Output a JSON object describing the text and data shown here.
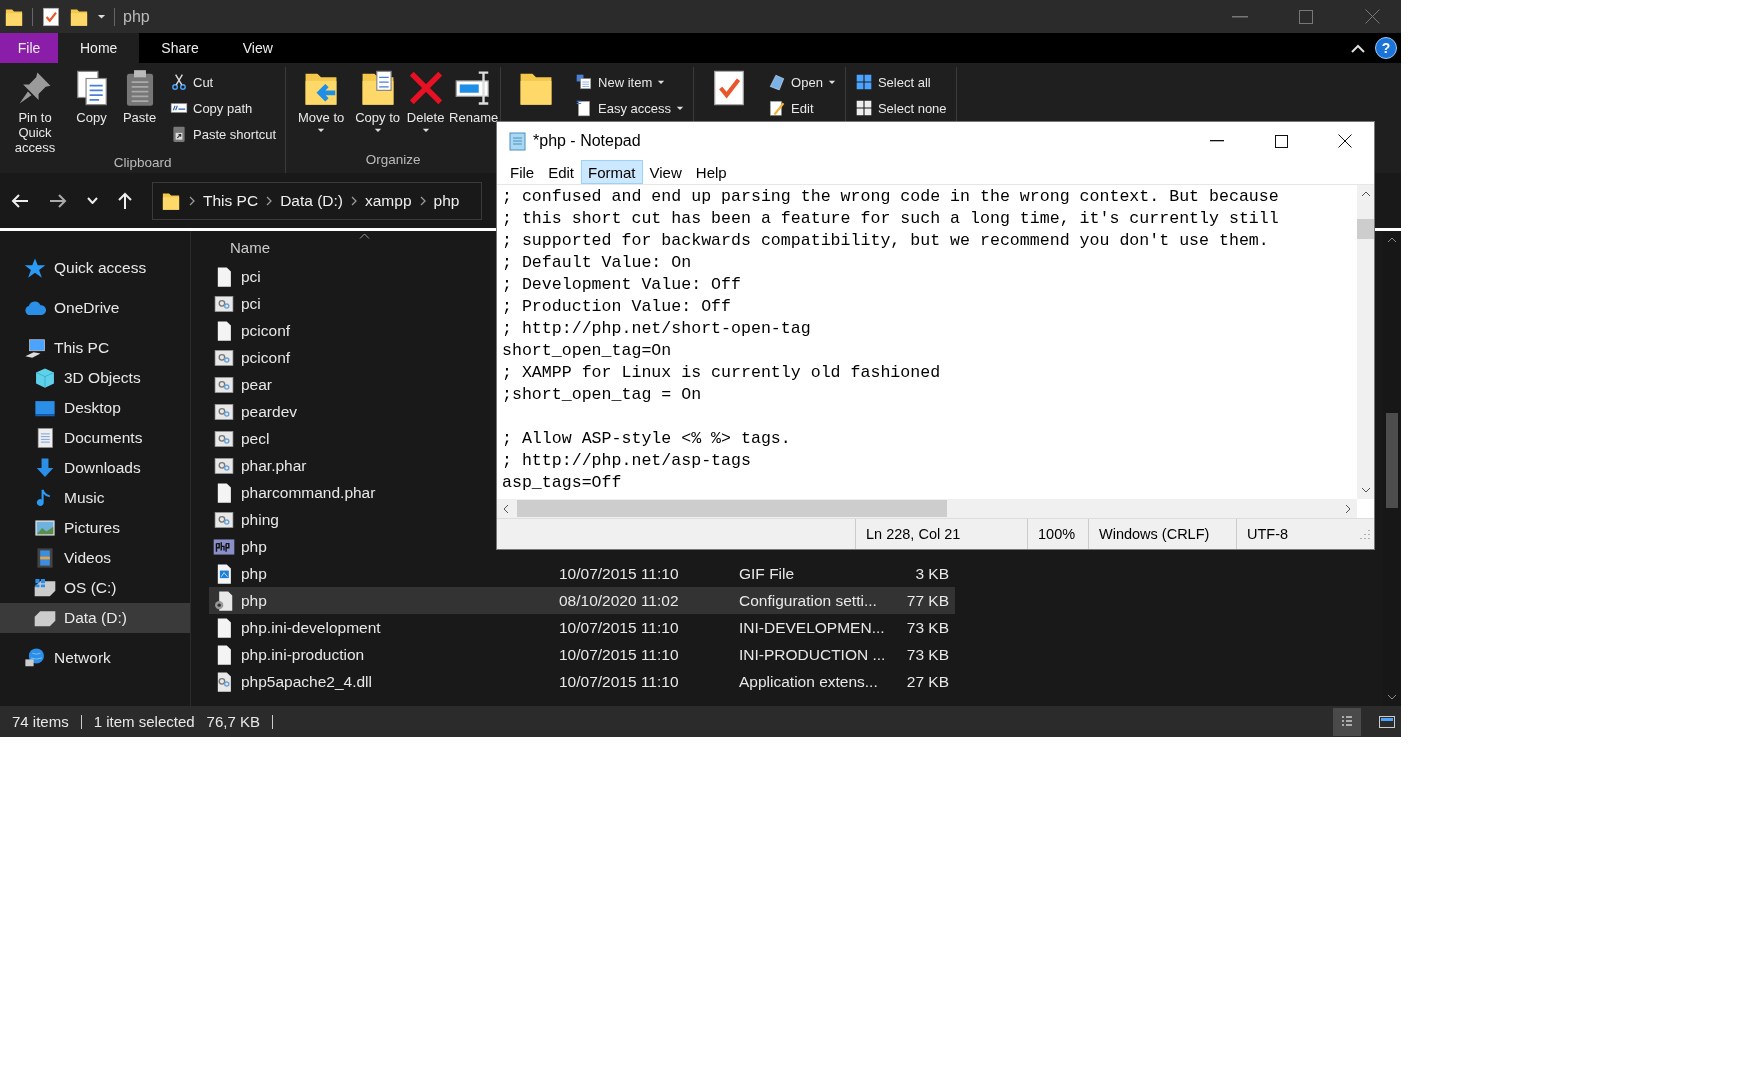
{
  "explorer": {
    "title": "php",
    "tabs": [
      {
        "label": "File",
        "kind": "file",
        "selected": false
      },
      {
        "label": "Home",
        "kind": "tab",
        "selected": true
      },
      {
        "label": "Share",
        "kind": "tab",
        "selected": false
      },
      {
        "label": "View",
        "kind": "tab",
        "selected": false
      }
    ],
    "help": "?",
    "ribbon": [
      {
        "label": "Clipboard",
        "large": [
          {
            "label": "Pin to Quick access",
            "kind": "pin"
          },
          {
            "label": "Copy",
            "kind": "copy"
          },
          {
            "label": "Paste",
            "kind": "paste"
          }
        ],
        "small": [
          {
            "label": "Cut",
            "kind": "cut"
          },
          {
            "label": "Copy path",
            "kind": "copypath"
          },
          {
            "label": "Paste shortcut",
            "kind": "shortcut"
          }
        ]
      },
      {
        "label": "Organize",
        "large": [
          {
            "label": "Move to",
            "kind": "move",
            "dropdown": true
          },
          {
            "label": "Copy to",
            "kind": "copyto",
            "dropdown": true
          },
          {
            "label": "Delete",
            "kind": "delete",
            "dropdown": true
          },
          {
            "label": "Rename",
            "kind": "rename"
          }
        ]
      },
      {
        "large": [
          {
            "kind": "newfolder"
          }
        ],
        "small": [
          {
            "label": "New item",
            "kind": "newitem",
            "dropdown": true
          },
          {
            "label": "Easy access",
            "kind": "easy",
            "dropdown": true
          }
        ]
      },
      {
        "large": [
          {
            "kind": "properties"
          }
        ],
        "small": [
          {
            "label": "Open",
            "kind": "open",
            "dropdown": true
          },
          {
            "label": "Edit",
            "kind": "edit"
          }
        ]
      },
      {
        "small": [
          {
            "label": "Select all",
            "kind": "selall"
          },
          {
            "label": "Select none",
            "kind": "selnone"
          }
        ]
      }
    ],
    "breadcrumb": [
      "This PC",
      "Data (D:)",
      "xampp",
      "php"
    ],
    "nav_pane": [
      {
        "label": "Quick access",
        "kind": "star",
        "selected": false
      },
      {
        "label": "OneDrive",
        "kind": "cloud",
        "selected": false
      },
      {
        "label": "This PC",
        "kind": "pc",
        "selected": false,
        "children": [
          {
            "label": "3D Objects",
            "kind": "cube",
            "selected": false
          },
          {
            "label": "Desktop",
            "kind": "desktop",
            "selected": false
          },
          {
            "label": "Documents",
            "kind": "documents",
            "selected": false
          },
          {
            "label": "Downloads",
            "kind": "download",
            "selected": false
          },
          {
            "label": "Music",
            "kind": "music",
            "selected": false
          },
          {
            "label": "Pictures",
            "kind": "pictures",
            "selected": false
          },
          {
            "label": "Videos",
            "kind": "videos",
            "selected": false
          },
          {
            "label": "OS (C:)",
            "kind": "osdrive",
            "selected": false
          },
          {
            "label": "Data (D:)",
            "kind": "drive",
            "selected": true
          }
        ]
      },
      {
        "label": "Network",
        "kind": "network",
        "selected": false
      }
    ],
    "file_list": {
      "columns": [
        "Name"
      ],
      "rows": [
        {
          "name": "pci",
          "kind": "blank",
          "selected": false
        },
        {
          "name": "pci",
          "kind": "system",
          "selected": false
        },
        {
          "name": "pciconf",
          "kind": "blank",
          "selected": false
        },
        {
          "name": "pciconf",
          "kind": "system",
          "selected": false
        },
        {
          "name": "pear",
          "kind": "system",
          "selected": false
        },
        {
          "name": "peardev",
          "kind": "system",
          "selected": false
        },
        {
          "name": "pecl",
          "kind": "system",
          "selected": false
        },
        {
          "name": "phar.phar",
          "kind": "system",
          "selected": false
        },
        {
          "name": "pharcommand.phar",
          "kind": "blank",
          "selected": false
        },
        {
          "name": "phing",
          "kind": "system",
          "selected": false
        },
        {
          "name": "php",
          "kind": "php",
          "selected": false
        },
        {
          "name": "php",
          "kind": "gif",
          "date": "10/07/2015 11:10",
          "type": "GIF File",
          "size": "3 KB",
          "selected": false
        },
        {
          "name": "php",
          "kind": "config",
          "date": "08/10/2020 11:02",
          "type": "Configuration setti...",
          "size": "77 KB",
          "selected": true
        },
        {
          "name": "php.ini-development",
          "kind": "blank",
          "date": "10/07/2015 11:10",
          "type": "INI-DEVELOPMEN...",
          "size": "73 KB",
          "selected": false
        },
        {
          "name": "php.ini-production",
          "kind": "blank",
          "date": "10/07/2015 11:10",
          "type": "INI-PRODUCTION ...",
          "size": "73 KB",
          "selected": false
        },
        {
          "name": "php5apache2_4.dll",
          "kind": "dll",
          "date": "10/07/2015 11:10",
          "type": "Application extens...",
          "size": "27 KB",
          "selected": false
        }
      ]
    },
    "status_bar": {
      "count": "74 items",
      "selection": "1 item selected",
      "size": "76,7 KB",
      "views": [
        {
          "kind": "details",
          "selected": true
        },
        {
          "kind": "tiles",
          "selected": false
        }
      ]
    }
  },
  "notepad": {
    "title": "*php - Notepad",
    "menu": [
      {
        "label": "File",
        "selected": false
      },
      {
        "label": "Edit",
        "selected": false
      },
      {
        "label": "Format",
        "selected": true
      },
      {
        "label": "View",
        "selected": false
      },
      {
        "label": "Help",
        "selected": false
      }
    ],
    "text": "; confused and end up parsing the wrong code in the wrong context. But because\n; this short cut has been a feature for such a long time, it's currently still\n; supported for backwards compatibility, but we recommend you don't use them.\n; Default Value: On\n; Development Value: Off\n; Production Value: Off\n; http://php.net/short-open-tag\nshort_open_tag=On\n; XAMPP for Linux is currently old fashioned\n;short_open_tag = On\n\n; Allow ASP-style <% %> tags.\n; http://php.net/asp-tags\nasp_tags=Off",
    "status": [
      "Ln 228, Col 21",
      "100%",
      "Windows (CRLF)",
      "UTF-8"
    ]
  }
}
